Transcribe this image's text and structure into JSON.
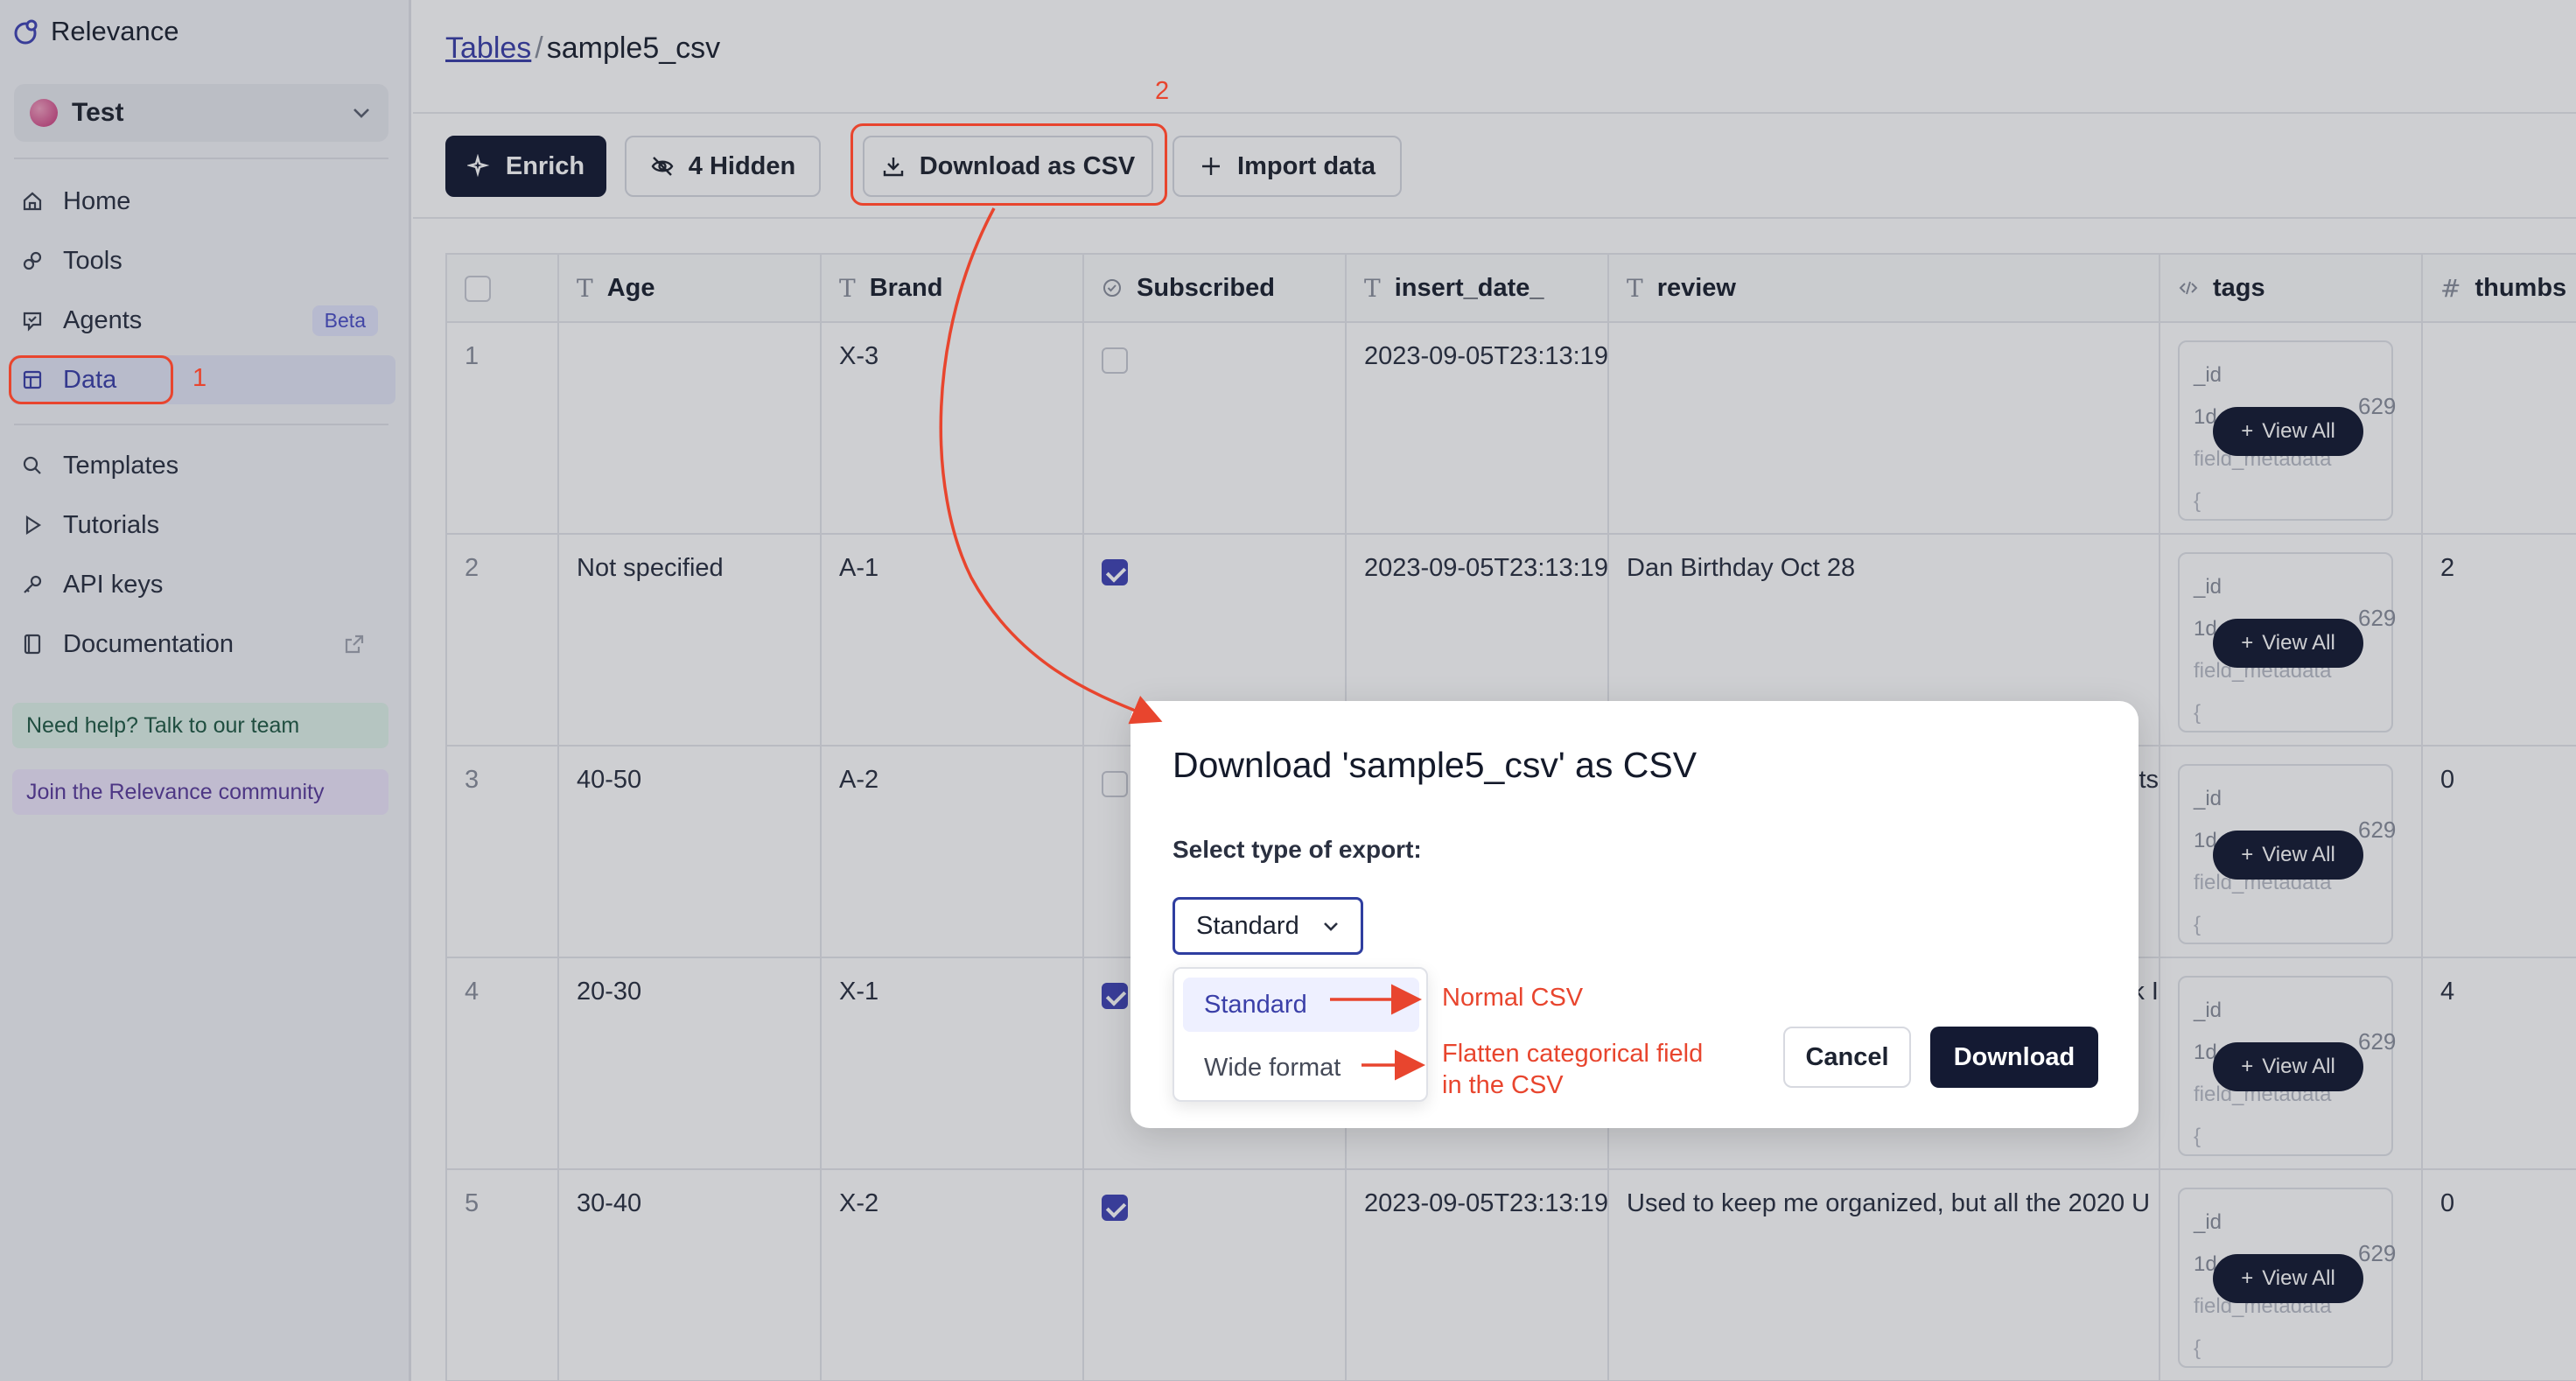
{
  "app": {
    "name": "Relevance"
  },
  "workspace": {
    "name": "Test"
  },
  "sidebar": {
    "items": [
      {
        "label": "Home",
        "icon": "home-icon"
      },
      {
        "label": "Tools",
        "icon": "tools-icon"
      },
      {
        "label": "Agents",
        "icon": "agents-icon",
        "badge": "Beta"
      },
      {
        "label": "Data",
        "icon": "data-icon",
        "active": true
      },
      {
        "label": "Templates",
        "icon": "search-icon"
      },
      {
        "label": "Tutorials",
        "icon": "play-icon"
      },
      {
        "label": "API keys",
        "icon": "key-icon"
      },
      {
        "label": "Documentation",
        "icon": "book-icon"
      }
    ],
    "help": "Need help? Talk to our team",
    "community": "Join the Relevance community"
  },
  "breadcrumb": {
    "root": "Tables",
    "separator": "/",
    "current": "sample5_csv"
  },
  "toolbar": {
    "enrich": "Enrich",
    "hidden": "4 Hidden",
    "download_csv": "Download as CSV",
    "import": "Import data"
  },
  "table": {
    "columns": [
      {
        "label": "Age",
        "icon": "T"
      },
      {
        "label": "Brand",
        "icon": "T"
      },
      {
        "label": "Subscribed",
        "icon": "check-circle-icon"
      },
      {
        "label": "insert_date_",
        "icon": "T"
      },
      {
        "label": "review",
        "icon": "T"
      },
      {
        "label": "tags",
        "icon": "code-icon"
      },
      {
        "label": "thumbs",
        "icon": "#"
      }
    ],
    "rows": [
      {
        "num": "1",
        "age": "",
        "brand": "X-3",
        "subscribed": false,
        "date": "2023-09-05T23:13:19.",
        "review": "",
        "thumbs": ""
      },
      {
        "num": "2",
        "age": "Not specified",
        "brand": "A-1",
        "subscribed": true,
        "date": "2023-09-05T23:13:19.",
        "review": "Dan Birthday Oct 28",
        "thumbs": "2"
      },
      {
        "num": "3",
        "age": "40-50",
        "brand": "A-2",
        "subscribed": false,
        "date": "",
        "review": "sts",
        "thumbs": "0"
      },
      {
        "num": "4",
        "age": "20-30",
        "brand": "X-1",
        "subscribed": true,
        "date": "",
        "review": "k I",
        "thumbs": "4"
      },
      {
        "num": "5",
        "age": "30-40",
        "brand": "X-2",
        "subscribed": true,
        "date": "2023-09-05T23:13:19.",
        "review": "Used to keep me organized, but all the 2020 U",
        "thumbs": "0"
      }
    ],
    "tag_preview": {
      "id": "_id",
      "value": "1d",
      "suffix": "629",
      "meta": "field_metadata",
      "more": "{"
    },
    "view_all": "View All"
  },
  "modal": {
    "title": "Download 'sample5_csv' as CSV",
    "label": "Select type of export:",
    "selected": "Standard",
    "options": [
      "Standard",
      "Wide format"
    ],
    "cancel": "Cancel",
    "download": "Download"
  },
  "annotations": {
    "step1": "1",
    "step2": "2",
    "standard_note": "Normal CSV",
    "wide_note_line1": "Flatten categorical field",
    "wide_note_line2": "in the CSV",
    "color": "#e8452e"
  },
  "colors": {
    "primary_dark": "#141a33",
    "accent": "#3a3fa8",
    "checkbox": "#4045b5"
  }
}
